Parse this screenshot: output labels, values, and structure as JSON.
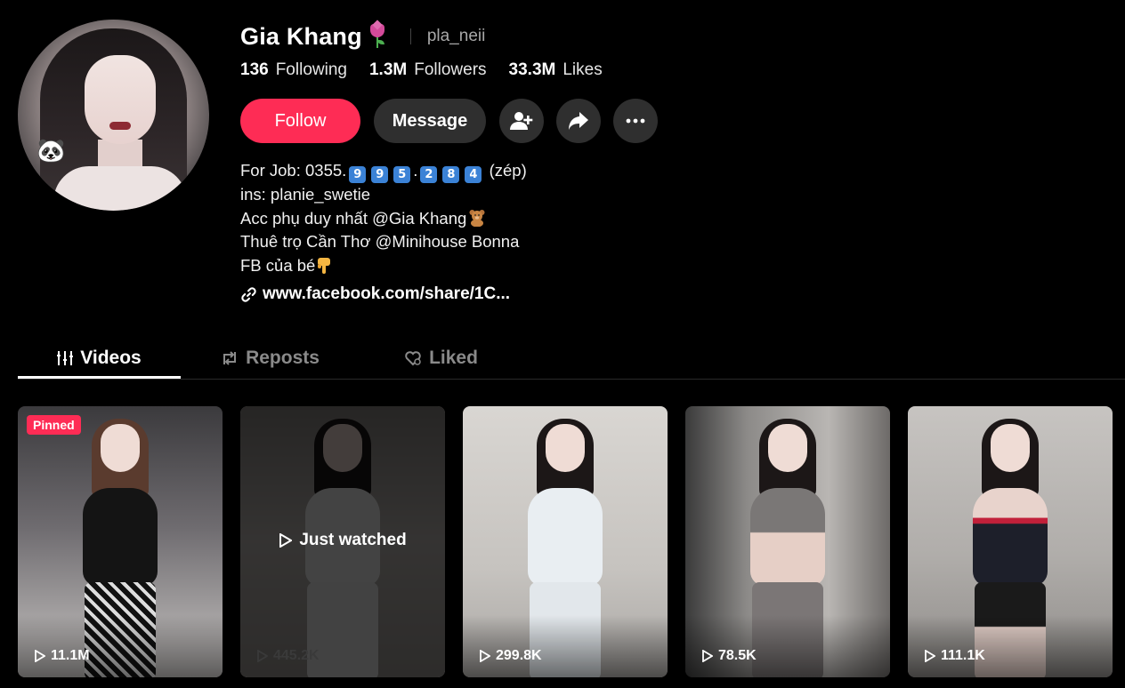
{
  "profile": {
    "display_name": "Gia Khang",
    "username": "pla_neii",
    "stats": [
      {
        "value": "136",
        "label": "Following"
      },
      {
        "value": "1.3M",
        "label": "Followers"
      },
      {
        "value": "33.3M",
        "label": "Likes"
      }
    ],
    "follow_label": "Follow",
    "message_label": "Message",
    "bio": {
      "line1_prefix": "For Job: 0355.",
      "line1_digits_a": [
        "9",
        "9",
        "5"
      ],
      "line1_dot": ".",
      "line1_digits_b": [
        "2",
        "8",
        "4"
      ],
      "line1_suffix": "(zép)",
      "line2": "ins: planie_swetie",
      "line3": "Acc phụ duy nhất @Gia Khang",
      "line4": "Thuê trọ Cần Thơ @Minihouse Bonna",
      "line5": "FB của bé"
    },
    "link": "www.facebook.com/share/1C..."
  },
  "tabs": [
    {
      "label": "Videos",
      "icon": "grid-bars-icon"
    },
    {
      "label": "Reposts",
      "icon": "repost-icon"
    },
    {
      "label": "Liked",
      "icon": "heart-outline-icon"
    }
  ],
  "videos": [
    {
      "views": "11.1M",
      "badge": "Pinned"
    },
    {
      "views": "445.2K",
      "overlay": "Just watched"
    },
    {
      "views": "299.8K"
    },
    {
      "views": "78.5K"
    },
    {
      "views": "111.1K"
    }
  ],
  "colors": {
    "accent": "#fe2c55",
    "button_bg": "#2f2f2f",
    "background": "#000000"
  }
}
